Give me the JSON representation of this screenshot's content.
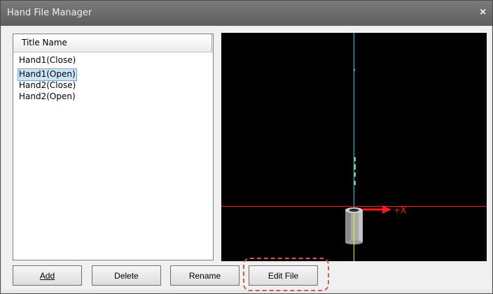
{
  "window": {
    "title": "Hand File Manager",
    "close_glyph": "×"
  },
  "list": {
    "header": "Title Name",
    "items": [
      "Hand1(Close)",
      "Hand1(Open)",
      "Hand2(Close)",
      "Hand2(Open)"
    ],
    "selected_index": 1
  },
  "viewport": {
    "axis_label": "+X",
    "background": "#000000",
    "x_axis_color": "#ff0000",
    "y_axis_color": "#00c8ff",
    "z_axis_color": "#ffff00"
  },
  "buttons": {
    "add": "Add",
    "delete": "Delete",
    "rename": "Rename",
    "edit_file": "Edit File"
  },
  "colors": {
    "highlight": "#d05a5a",
    "selection": "#cce4f7"
  }
}
